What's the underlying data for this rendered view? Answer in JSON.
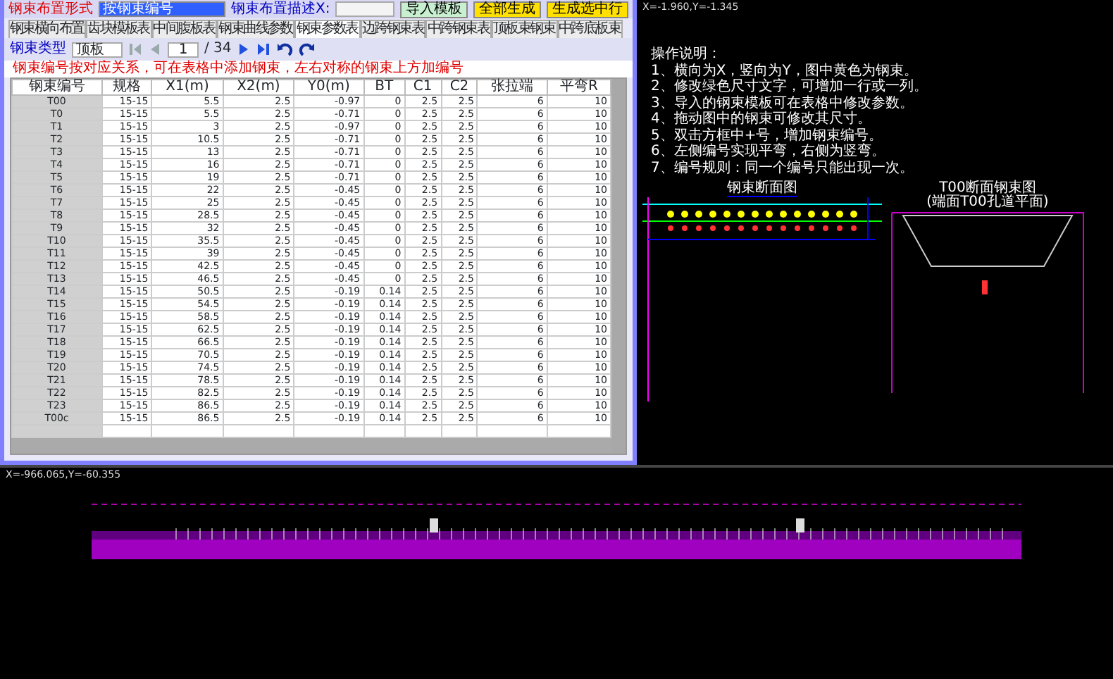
{
  "toolbar": {
    "layout_label": "钢束布置形式",
    "layout_value": "按钢束编号",
    "desc_label": "钢束布置描述X:",
    "buttons": [
      {
        "label": "导入模板",
        "kind": "normal"
      },
      {
        "label": "全部生成",
        "kind": "accent"
      },
      {
        "label": "生成选中行",
        "kind": "accent"
      }
    ]
  },
  "tabs": [
    {
      "label": "钢束横向布置",
      "selected": false
    },
    {
      "label": "齿块模板表",
      "selected": false
    },
    {
      "label": "中间腹板表",
      "selected": false
    },
    {
      "label": "钢束曲线参数",
      "selected": false
    },
    {
      "label": "钢束参数表",
      "selected": true
    },
    {
      "label": "边跨钢束表",
      "selected": false
    },
    {
      "label": "中跨钢束表",
      "selected": false
    },
    {
      "label": "顶板束钢束",
      "selected": false
    },
    {
      "label": "中跨底板束",
      "selected": false
    }
  ],
  "nav": {
    "type_label": "钢束类型",
    "type_value": "顶板",
    "page": "1",
    "page_total": "/ 34"
  },
  "note": "钢束编号按对应关系，可在表格中添加钢束，左右对称的钢束上方加编号",
  "table": {
    "columns": [
      "钢束编号",
      "规格",
      "X1(m)",
      "X2(m)",
      "Y0(m)",
      "BT",
      "C1",
      "C2",
      "张拉端",
      "平弯R"
    ],
    "rows": [
      [
        "T00",
        "15-15",
        "5.5",
        "2.5",
        "-0.97",
        "0",
        "2.5",
        "2.5",
        "6",
        "10"
      ],
      [
        "T0",
        "15-15",
        "5.5",
        "2.5",
        "-0.71",
        "0",
        "2.5",
        "2.5",
        "6",
        "10"
      ],
      [
        "T1",
        "15-15",
        "3",
        "2.5",
        "-0.97",
        "0",
        "2.5",
        "2.5",
        "6",
        "10"
      ],
      [
        "T2",
        "15-15",
        "10.5",
        "2.5",
        "-0.71",
        "0",
        "2.5",
        "2.5",
        "6",
        "10"
      ],
      [
        "T3",
        "15-15",
        "13",
        "2.5",
        "-0.71",
        "0",
        "2.5",
        "2.5",
        "6",
        "10"
      ],
      [
        "T4",
        "15-15",
        "16",
        "2.5",
        "-0.71",
        "0",
        "2.5",
        "2.5",
        "6",
        "10"
      ],
      [
        "T5",
        "15-15",
        "19",
        "2.5",
        "-0.71",
        "0",
        "2.5",
        "2.5",
        "6",
        "10"
      ],
      [
        "T6",
        "15-15",
        "22",
        "2.5",
        "-0.45",
        "0",
        "2.5",
        "2.5",
        "6",
        "10"
      ],
      [
        "T7",
        "15-15",
        "25",
        "2.5",
        "-0.45",
        "0",
        "2.5",
        "2.5",
        "6",
        "10"
      ],
      [
        "T8",
        "15-15",
        "28.5",
        "2.5",
        "-0.45",
        "0",
        "2.5",
        "2.5",
        "6",
        "10"
      ],
      [
        "T9",
        "15-15",
        "32",
        "2.5",
        "-0.45",
        "0",
        "2.5",
        "2.5",
        "6",
        "10"
      ],
      [
        "T10",
        "15-15",
        "35.5",
        "2.5",
        "-0.45",
        "0",
        "2.5",
        "2.5",
        "6",
        "10"
      ],
      [
        "T11",
        "15-15",
        "39",
        "2.5",
        "-0.45",
        "0",
        "2.5",
        "2.5",
        "6",
        "10"
      ],
      [
        "T12",
        "15-15",
        "42.5",
        "2.5",
        "-0.45",
        "0",
        "2.5",
        "2.5",
        "6",
        "10"
      ],
      [
        "T13",
        "15-15",
        "46.5",
        "2.5",
        "-0.45",
        "0",
        "2.5",
        "2.5",
        "6",
        "10"
      ],
      [
        "T14",
        "15-15",
        "50.5",
        "2.5",
        "-0.19",
        "0.14",
        "2.5",
        "2.5",
        "6",
        "10"
      ],
      [
        "T15",
        "15-15",
        "54.5",
        "2.5",
        "-0.19",
        "0.14",
        "2.5",
        "2.5",
        "6",
        "10"
      ],
      [
        "T16",
        "15-15",
        "58.5",
        "2.5",
        "-0.19",
        "0.14",
        "2.5",
        "2.5",
        "6",
        "10"
      ],
      [
        "T17",
        "15-15",
        "62.5",
        "2.5",
        "-0.19",
        "0.14",
        "2.5",
        "2.5",
        "6",
        "10"
      ],
      [
        "T18",
        "15-15",
        "66.5",
        "2.5",
        "-0.19",
        "0.14",
        "2.5",
        "2.5",
        "6",
        "10"
      ],
      [
        "T19",
        "15-15",
        "70.5",
        "2.5",
        "-0.19",
        "0.14",
        "2.5",
        "2.5",
        "6",
        "10"
      ],
      [
        "T20",
        "15-15",
        "74.5",
        "2.5",
        "-0.19",
        "0.14",
        "2.5",
        "2.5",
        "6",
        "10"
      ],
      [
        "T21",
        "15-15",
        "78.5",
        "2.5",
        "-0.19",
        "0.14",
        "2.5",
        "2.5",
        "6",
        "10"
      ],
      [
        "T22",
        "15-15",
        "82.5",
        "2.5",
        "-0.19",
        "0.14",
        "2.5",
        "2.5",
        "6",
        "10"
      ],
      [
        "T23",
        "15-15",
        "86.5",
        "2.5",
        "-0.19",
        "0.14",
        "2.5",
        "2.5",
        "6",
        "10"
      ],
      [
        "T00c",
        "15-15",
        "86.5",
        "2.5",
        "-0.19",
        "0.14",
        "2.5",
        "2.5",
        "6",
        "10"
      ]
    ]
  },
  "cad_view": {
    "coords": "X=-1.960,Y=-1.345",
    "notes_title": "操作说明：",
    "notes": [
      "1、横向为X，竖向为Y，图中黄色为钢束。",
      "2、修改绿色尺寸文字，可增加一行或一列。",
      "3、导入的钢束模板可在表格中修改参数。",
      "4、拖动图中的钢束可修改其尺寸。",
      "5、双击方框中+号，增加钢束编号。",
      "6、左侧编号实现平弯，右侧为竖弯。",
      "7、编号规则：同一个编号只能出现一次。"
    ],
    "section_label": "钢束断面图",
    "detail_label": "T00断面钢束图",
    "detail_sublabel": "(端面T00孔道平面)"
  },
  "plan_view": {
    "coords": "X=-966.065,Y=-60.355"
  }
}
